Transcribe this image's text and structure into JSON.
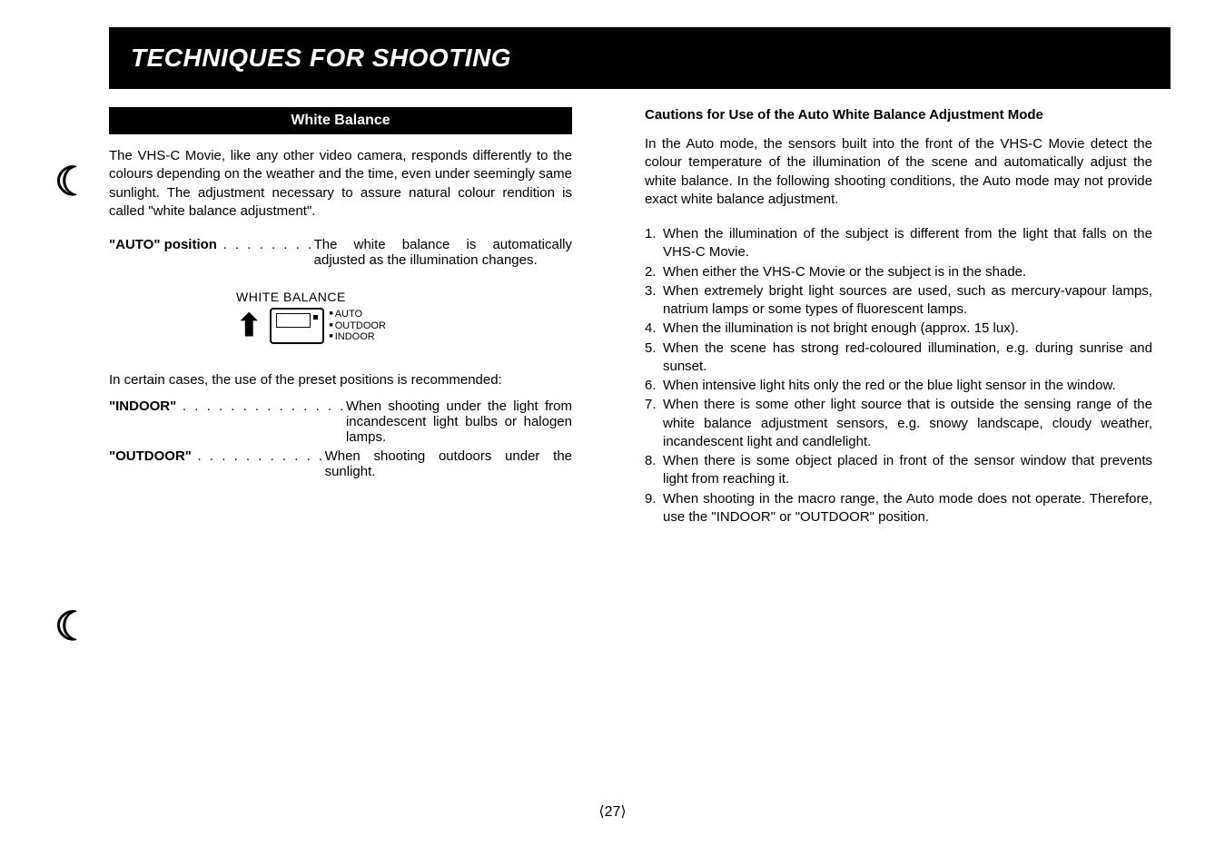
{
  "title": "TECHNIQUES FOR SHOOTING",
  "left": {
    "heading": "White Balance",
    "intro": "The VHS-C Movie, like any other video camera, responds differently to the colours depending on the weather and the time, even under seemingly same sunlight. The adjustment necessary to assure natural colour rendition is called \"white balance adjustment\".",
    "auto_label": "\"AUTO\" position",
    "auto_dots": " . . . . . . . .",
    "auto_desc": "The white balance is automatically adjusted as the illumination changes.",
    "switch_title": "WHITE BALANCE",
    "switch_opts": {
      "a": "AUTO",
      "b": "OUTDOOR",
      "c": "INDOOR"
    },
    "preset_intro": "In certain cases, the use of the preset positions is recommended:",
    "indoor_label": "\"INDOOR\"",
    "indoor_dots": " . . . . . . . . . . . . . .",
    "indoor_desc": "When shooting under the light from incandescent light bulbs or halogen lamps.",
    "outdoor_label": "\"OUTDOOR\"",
    "outdoor_dots": " . . . . . . . . . . .",
    "outdoor_desc": "When shooting outdoors under the sunlight."
  },
  "right": {
    "heading": "Cautions for Use of the Auto White Balance Adjustment Mode",
    "intro": "In the Auto mode, the sensors built into the front of the VHS-C Movie detect the colour temperature of the illumination of the scene and automatically adjust the white balance. In the following shooting conditions, the Auto mode may not provide exact white balance adjustment.",
    "items": [
      "When the illumination of the subject is different from the light that falls on the VHS-C Movie.",
      "When either the VHS-C Movie or the subject is in the shade.",
      "When extremely bright light sources are used, such as mercury-vapour lamps, natrium lamps or some types of fluorescent lamps.",
      "When the illumination is not bright enough (approx. 15 lux).",
      "When the scene has strong red-coloured illumination, e.g. during sunrise and sunset.",
      "When intensive light hits only the red or the blue light sensor in the window.",
      "When there is some other light source that is outside the sensing range of the white balance adjustment sensors, e.g. snowy landscape, cloudy weather, incandescent light and candlelight.",
      "When there is some object placed in front of the sensor window that prevents light from reaching it.",
      "When shooting in the macro range, the Auto mode does not operate. Therefore, use the \"INDOOR\" or \"OUTDOOR\" position."
    ]
  },
  "page_number": "⟨27⟩"
}
